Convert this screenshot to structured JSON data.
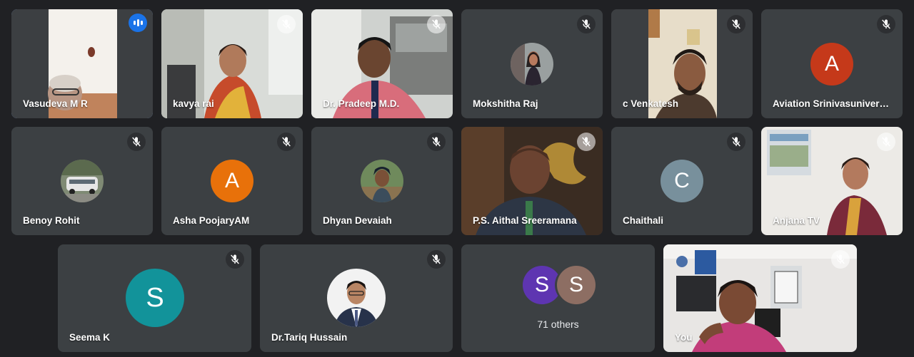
{
  "participants": [
    {
      "name": "Vasudeva M R"
    },
    {
      "name": "kavya rai"
    },
    {
      "name": "Dr. Pradeep M.D."
    },
    {
      "name": "Mokshitha Raj"
    },
    {
      "name": "c Venkatesh"
    },
    {
      "name": "Aviation Srinivasuniver…",
      "initial": "A",
      "color": "#c5391a"
    },
    {
      "name": "Benoy Rohit"
    },
    {
      "name": "Asha PoojaryAM",
      "initial": "A",
      "color": "#e8710a"
    },
    {
      "name": "Dhyan Devaiah"
    },
    {
      "name": "P.S. Aithal Sreeramana"
    },
    {
      "name": "Chaithali",
      "initial": "C",
      "color": "#78909c"
    },
    {
      "name": "Anjana TV"
    },
    {
      "name": "Seema K",
      "initial": "S",
      "color": "#12939a"
    },
    {
      "name": "Dr.Tariq Hussain"
    },
    {
      "name": "You"
    }
  ],
  "others": {
    "label": "71 others",
    "avatars": [
      {
        "initial": "S",
        "color": "#5e35b1"
      },
      {
        "initial": "S",
        "color": "#8d6e63"
      }
    ]
  },
  "icons": {
    "muted": "mic-off-icon",
    "speaking": "audio-level-icon"
  },
  "accent": "#8ab4f8"
}
